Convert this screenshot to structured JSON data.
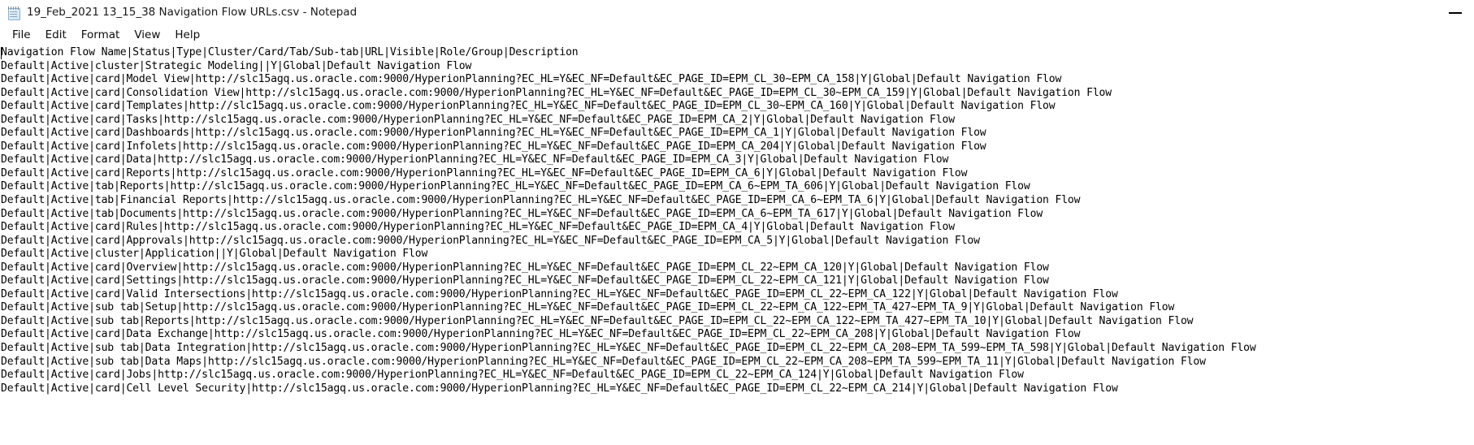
{
  "window": {
    "title": "19_Feb_2021 13_15_38 Navigation Flow URLs.csv - Notepad",
    "icon": "notepad-icon",
    "minimize_label": "—"
  },
  "menubar": {
    "items": [
      {
        "label": "File",
        "name": "menu-file"
      },
      {
        "label": "Edit",
        "name": "menu-edit"
      },
      {
        "label": "Format",
        "name": "menu-format"
      },
      {
        "label": "View",
        "name": "menu-view"
      },
      {
        "label": "Help",
        "name": "menu-help"
      }
    ]
  },
  "document": {
    "header_line": "Navigation Flow Name|Status|Type|Cluster/Card/Tab/Sub-tab|URL|Visible|Role/Group|Description",
    "lines": [
      "Navigation Flow Name|Status|Type|Cluster/Card/Tab/Sub-tab|URL|Visible|Role/Group|Description",
      "Default|Active|cluster|Strategic Modeling||Y|Global|Default Navigation Flow",
      "Default|Active|card|Model View|http://slc15agq.us.oracle.com:9000/HyperionPlanning?EC_HL=Y&EC_NF=Default&EC_PAGE_ID=EPM_CL_30~EPM_CA_158|Y|Global|Default Navigation Flow",
      "Default|Active|card|Consolidation View|http://slc15agq.us.oracle.com:9000/HyperionPlanning?EC_HL=Y&EC_NF=Default&EC_PAGE_ID=EPM_CL_30~EPM_CA_159|Y|Global|Default Navigation Flow",
      "Default|Active|card|Templates|http://slc15agq.us.oracle.com:9000/HyperionPlanning?EC_HL=Y&EC_NF=Default&EC_PAGE_ID=EPM_CL_30~EPM_CA_160|Y|Global|Default Navigation Flow",
      "Default|Active|card|Tasks|http://slc15agq.us.oracle.com:9000/HyperionPlanning?EC_HL=Y&EC_NF=Default&EC_PAGE_ID=EPM_CA_2|Y|Global|Default Navigation Flow",
      "Default|Active|card|Dashboards|http://slc15agq.us.oracle.com:9000/HyperionPlanning?EC_HL=Y&EC_NF=Default&EC_PAGE_ID=EPM_CA_1|Y|Global|Default Navigation Flow",
      "Default|Active|card|Infolets|http://slc15agq.us.oracle.com:9000/HyperionPlanning?EC_HL=Y&EC_NF=Default&EC_PAGE_ID=EPM_CA_204|Y|Global|Default Navigation Flow",
      "Default|Active|card|Data|http://slc15agq.us.oracle.com:9000/HyperionPlanning?EC_HL=Y&EC_NF=Default&EC_PAGE_ID=EPM_CA_3|Y|Global|Default Navigation Flow",
      "Default|Active|card|Reports|http://slc15agq.us.oracle.com:9000/HyperionPlanning?EC_HL=Y&EC_NF=Default&EC_PAGE_ID=EPM_CA_6|Y|Global|Default Navigation Flow",
      "Default|Active|tab|Reports|http://slc15agq.us.oracle.com:9000/HyperionPlanning?EC_HL=Y&EC_NF=Default&EC_PAGE_ID=EPM_CA_6~EPM_TA_606|Y|Global|Default Navigation Flow",
      "Default|Active|tab|Financial Reports|http://slc15agq.us.oracle.com:9000/HyperionPlanning?EC_HL=Y&EC_NF=Default&EC_PAGE_ID=EPM_CA_6~EPM_TA_6|Y|Global|Default Navigation Flow",
      "Default|Active|tab|Documents|http://slc15agq.us.oracle.com:9000/HyperionPlanning?EC_HL=Y&EC_NF=Default&EC_PAGE_ID=EPM_CA_6~EPM_TA_617|Y|Global|Default Navigation Flow",
      "Default|Active|card|Rules|http://slc15agq.us.oracle.com:9000/HyperionPlanning?EC_HL=Y&EC_NF=Default&EC_PAGE_ID=EPM_CA_4|Y|Global|Default Navigation Flow",
      "Default|Active|card|Approvals|http://slc15agq.us.oracle.com:9000/HyperionPlanning?EC_HL=Y&EC_NF=Default&EC_PAGE_ID=EPM_CA_5|Y|Global|Default Navigation Flow",
      "Default|Active|cluster|Application||Y|Global|Default Navigation Flow",
      "Default|Active|card|Overview|http://slc15agq.us.oracle.com:9000/HyperionPlanning?EC_HL=Y&EC_NF=Default&EC_PAGE_ID=EPM_CL_22~EPM_CA_120|Y|Global|Default Navigation Flow",
      "Default|Active|card|Settings|http://slc15agq.us.oracle.com:9000/HyperionPlanning?EC_HL=Y&EC_NF=Default&EC_PAGE_ID=EPM_CL_22~EPM_CA_121|Y|Global|Default Navigation Flow",
      "Default|Active|card|Valid Intersections|http://slc15agq.us.oracle.com:9000/HyperionPlanning?EC_HL=Y&EC_NF=Default&EC_PAGE_ID=EPM_CL_22~EPM_CA_122|Y|Global|Default Navigation Flow",
      "Default|Active|sub tab|Setup|http://slc15agq.us.oracle.com:9000/HyperionPlanning?EC_HL=Y&EC_NF=Default&EC_PAGE_ID=EPM_CL_22~EPM_CA_122~EPM_TA_427~EPM_TA_9|Y|Global|Default Navigation Flow",
      "Default|Active|sub tab|Reports|http://slc15agq.us.oracle.com:9000/HyperionPlanning?EC_HL=Y&EC_NF=Default&EC_PAGE_ID=EPM_CL_22~EPM_CA_122~EPM_TA_427~EPM_TA_10|Y|Global|Default Navigation Flow",
      "Default|Active|card|Data Exchange|http://slc15agq.us.oracle.com:9000/HyperionPlanning?EC_HL=Y&EC_NF=Default&EC_PAGE_ID=EPM_CL_22~EPM_CA_208|Y|Global|Default Navigation Flow",
      "Default|Active|sub tab|Data Integration|http://slc15agq.us.oracle.com:9000/HyperionPlanning?EC_HL=Y&EC_NF=Default&EC_PAGE_ID=EPM_CL_22~EPM_CA_208~EPM_TA_599~EPM_TA_598|Y|Global|Default Navigation Flow",
      "Default|Active|sub tab|Data Maps|http://slc15agq.us.oracle.com:9000/HyperionPlanning?EC_HL=Y&EC_NF=Default&EC_PAGE_ID=EPM_CL_22~EPM_CA_208~EPM_TA_599~EPM_TA_11|Y|Global|Default Navigation Flow",
      "Default|Active|card|Jobs|http://slc15agq.us.oracle.com:9000/HyperionPlanning?EC_HL=Y&EC_NF=Default&EC_PAGE_ID=EPM_CL_22~EPM_CA_124|Y|Global|Default Navigation Flow",
      "Default|Active|card|Cell Level Security|http://slc15agq.us.oracle.com:9000/HyperionPlanning?EC_HL=Y&EC_NF=Default&EC_PAGE_ID=EPM_CL_22~EPM_CA_214|Y|Global|Default Navigation Flow"
    ]
  }
}
